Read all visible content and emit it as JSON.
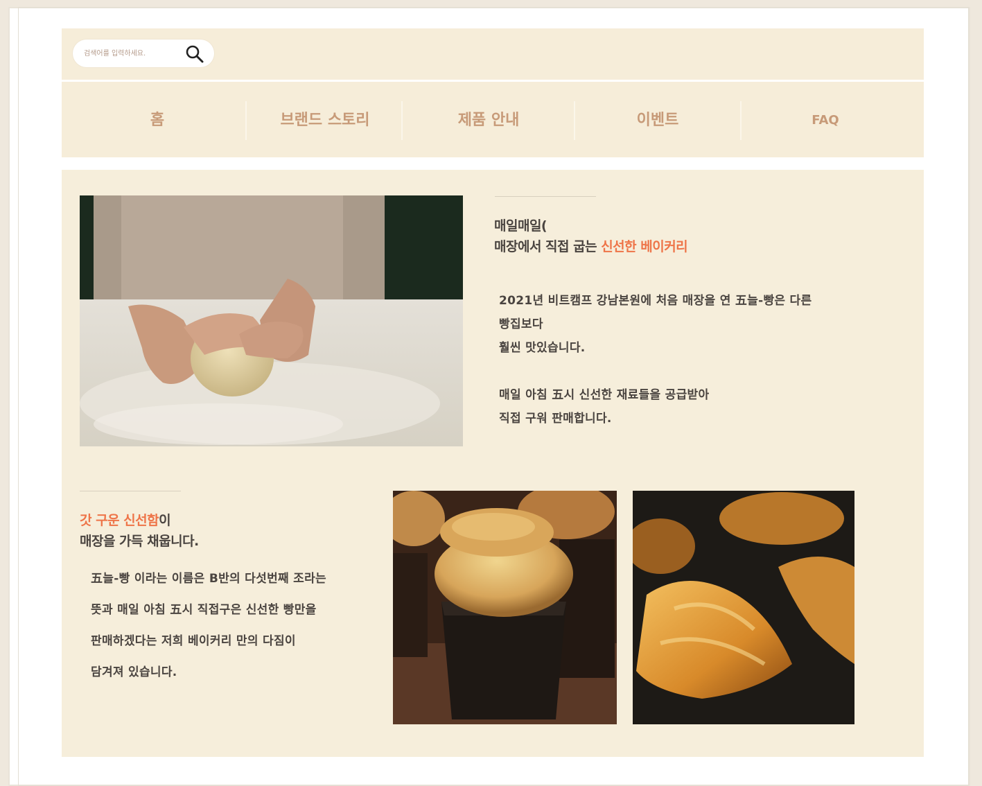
{
  "search": {
    "placeholder": "검색어를 입력하세요."
  },
  "nav": {
    "items": [
      {
        "label": "홈"
      },
      {
        "label": "브랜드 스토리"
      },
      {
        "label": "제품 안내"
      },
      {
        "label": "이벤트"
      },
      {
        "label": "FAQ"
      }
    ]
  },
  "section1": {
    "headline_line1": "매일매일(",
    "headline_line2_plain": "매장에서 직접 굽는 ",
    "headline_line2_accent": "신선한 베이커리",
    "paragraph1": [
      "2021년 비트캠프 강남본원에 처음 매장을 연 五늘-빵은 다른",
      "빵집보다",
      "훨씬 맛있습니다."
    ],
    "paragraph2": [
      "매일 아침 五시 신선한 재료들을 공급받아",
      "직접 구워 판매합니다."
    ]
  },
  "section2": {
    "headline_line1_accent": "갓 구운 신선함",
    "headline_line1_plain": "이",
    "headline_line2": "매장을 가득 채웁니다.",
    "paragraph": [
      "五늘-빵 이라는 이름은 B반의 다섯번째 조라는",
      "뜻과 매일 아침 五시 직접구은 신선한 빵만을",
      "판매하겠다는 저희 베이커리 만의 다짐이",
      "담겨져 있습니다."
    ]
  },
  "colors": {
    "accent": "#ee7448",
    "nav_text": "#c79a78",
    "header_bg": "#f6edd9",
    "content_bg": "#f6eedb",
    "body_text": "#4a4440"
  }
}
